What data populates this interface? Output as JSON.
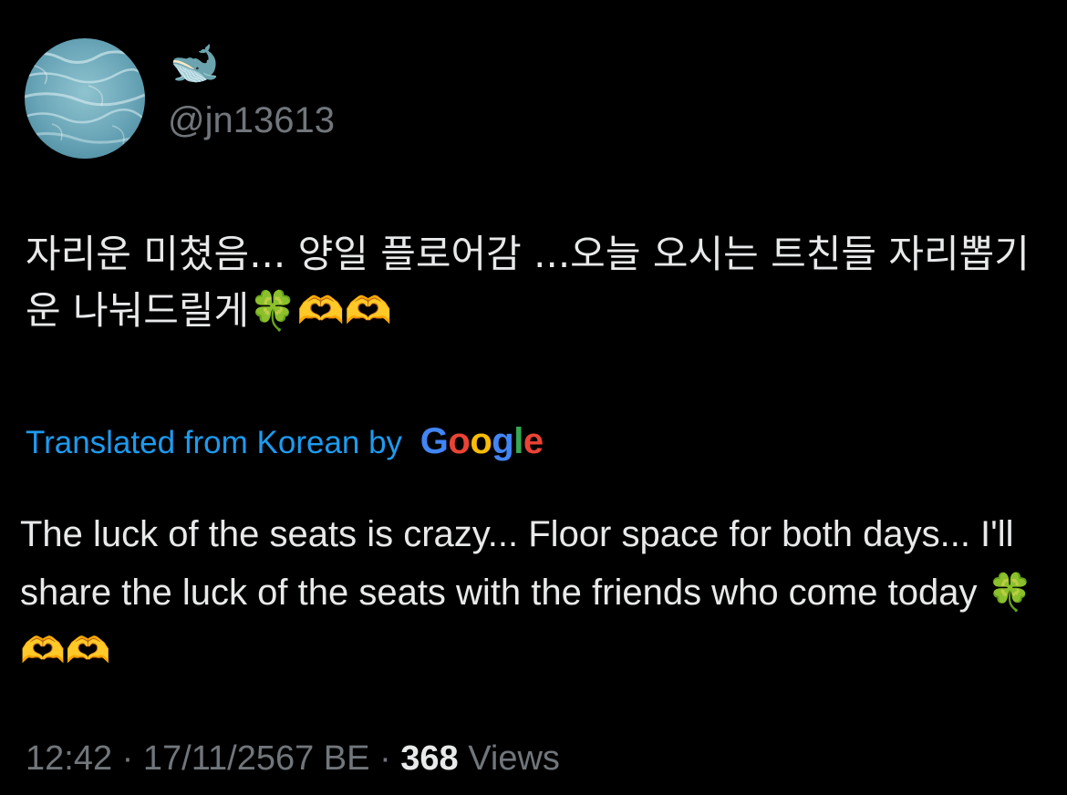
{
  "author": {
    "display_name": "🐋",
    "handle": "@jn13613"
  },
  "tweet": {
    "original_text": "자리운 미쳤음... 양일 플로어감 ...오늘 오시는 트친들 자리뽑기운 나눠드릴게🍀🫶🫶",
    "translation_label": "Translated from Korean by",
    "translation_provider": "Google",
    "translated_text": "The luck of the seats is crazy... Floor space for both days... I'll share the luck of the seats with the friends who come today 🍀🫶🫶"
  },
  "meta": {
    "time": "12:42",
    "separator": "·",
    "date": "17/11/2567 BE",
    "views_count": "368",
    "views_label": "Views"
  },
  "colors": {
    "background": "#000000",
    "text_primary": "#e7e9ea",
    "text_secondary": "#71767b",
    "link_blue": "#1d9bf0"
  },
  "icons": {
    "avatar": "ocean-water-avatar",
    "display_name_emoji": "whale-emoji"
  }
}
